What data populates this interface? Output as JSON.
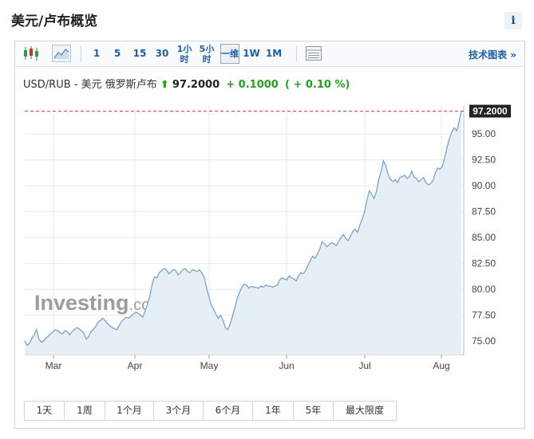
{
  "header": {
    "title": "美元/卢布概览",
    "info_label": "i"
  },
  "toolbar": {
    "icons": [
      "candlestick-icon",
      "area-chart-icon",
      "table-icon"
    ],
    "intervals": [
      {
        "label": "1"
      },
      {
        "label": "5"
      },
      {
        "label": "15"
      },
      {
        "label": "30"
      },
      {
        "label": "1小时"
      },
      {
        "label": "5小时"
      },
      {
        "label": "一维",
        "active": true
      },
      {
        "label": "1W"
      },
      {
        "label": "1M"
      }
    ],
    "tech_link": "技术图表 »"
  },
  "pair": {
    "name": "USD/RUB - 美元 俄罗斯卢布",
    "arrow": "⬆",
    "price": "97.2000",
    "change": "+ 0.1000",
    "change_pct": "( + 0.10 %)"
  },
  "watermark": {
    "brand": "Investing",
    "suffix": ".com"
  },
  "ranges": [
    "1天",
    "1周",
    "1个月",
    "3个月",
    "6个月",
    "1年",
    "5年",
    "最大限度"
  ],
  "colors": {
    "line": "#7da4c8",
    "fill": "#e6eef6",
    "grid": "#e8e8e8",
    "up": "#23a11c",
    "ref_line": "#c0504d",
    "link": "#1b5fa8"
  },
  "chart_data": {
    "type": "area",
    "x_ticks": [
      "Mar",
      "Apr",
      "May",
      "Jun",
      "Jul",
      "Aug"
    ],
    "y_ticks": [
      "75.00",
      "77.50",
      "80.00",
      "82.50",
      "85.00",
      "87.50",
      "90.00",
      "92.50",
      "95.00"
    ],
    "last_label": "97.2000",
    "ylim": [
      73.7,
      97.7
    ],
    "y_axis_side": "right",
    "grid": true,
    "series": [
      {
        "values": [
          75.0,
          74.6,
          74.8,
          75.3,
          75.6,
          76.1,
          75.2,
          74.9,
          75.0,
          75.3,
          75.5,
          75.7,
          75.9,
          76.1,
          76.0,
          75.8,
          75.7,
          76.0,
          75.9,
          75.6,
          75.9,
          76.1,
          76.3,
          76.2,
          76.0,
          75.8,
          75.2,
          75.4,
          75.9,
          76.1,
          76.4,
          76.8,
          77.0,
          77.2,
          77.0,
          76.7,
          76.5,
          76.3,
          76.2,
          76.1,
          76.5,
          76.9,
          77.1,
          77.3,
          77.2,
          77.4,
          77.6,
          77.8,
          77.7,
          77.5,
          77.3,
          77.9,
          78.6,
          79.3,
          80.5,
          81.2,
          81.1,
          81.6,
          81.8,
          82.0,
          81.9,
          81.5,
          81.7,
          81.9,
          81.8,
          81.4,
          81.6,
          81.9,
          82.0,
          81.7,
          81.6,
          81.9,
          81.8,
          81.7,
          81.9,
          81.6,
          81.2,
          80.2,
          79.3,
          78.5,
          78.1,
          77.6,
          77.2,
          77.5,
          77.0,
          76.3,
          76.1,
          76.6,
          77.4,
          78.2,
          79.1,
          79.7,
          80.2,
          80.5,
          80.4,
          80.1,
          80.3,
          80.2,
          80.2,
          80.1,
          80.3,
          80.2,
          80.4,
          80.3,
          80.3,
          80.2,
          80.3,
          80.4,
          80.9,
          81.1,
          81.0,
          80.9,
          81.3,
          81.1,
          81.0,
          80.8,
          81.3,
          81.6,
          81.5,
          81.8,
          82.3,
          82.8,
          83.2,
          83.0,
          83.4,
          83.9,
          84.6,
          84.4,
          84.1,
          84.3,
          84.5,
          84.4,
          84.2,
          84.6,
          85.0,
          85.3,
          84.9,
          84.7,
          85.1,
          85.6,
          85.8,
          85.5,
          86.2,
          86.8,
          87.5,
          88.6,
          89.5,
          89.2,
          88.8,
          89.4,
          90.6,
          91.4,
          92.4,
          91.9,
          91.1,
          90.6,
          90.4,
          90.6,
          90.3,
          90.8,
          90.9,
          91.0,
          90.7,
          90.9,
          91.4,
          90.8,
          90.7,
          90.4,
          90.6,
          90.8,
          90.3,
          90.1,
          90.2,
          90.5,
          91.3,
          91.7,
          91.6,
          91.9,
          92.7,
          93.8,
          94.6,
          95.2,
          95.6,
          95.3,
          96.1,
          97.2
        ]
      }
    ]
  }
}
